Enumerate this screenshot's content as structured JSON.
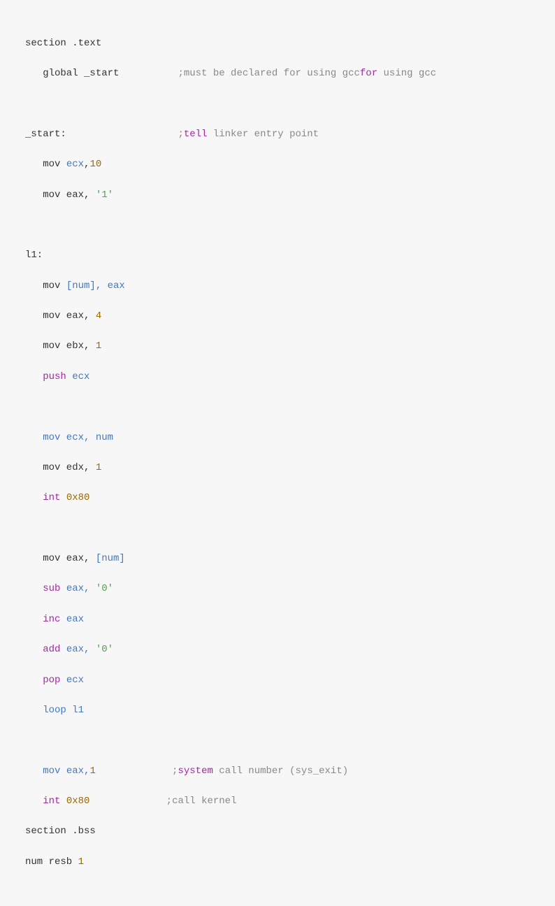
{
  "code": {
    "l0": {
      "a": "section .text"
    },
    "l1": {
      "a": "   global _start          ",
      "b": ";must be declared for using gcc",
      "c": "for",
      "d": " using gcc"
    },
    "l2": {
      "a": "_start:                   ",
      "b": ";",
      "c": "tell",
      "d": " linker entry point"
    },
    "l3": {
      "a": "   mov ",
      "b": "ecx",
      "c": ",",
      "d": "10"
    },
    "l4": {
      "a": "   mov eax, ",
      "b": "'1'"
    },
    "l5": {
      "a": "l1:"
    },
    "l6": {
      "a": "   mov ",
      "b": "[num], eax"
    },
    "l7": {
      "a": "   mov eax, ",
      "b": "4"
    },
    "l8": {
      "a": "   mov ebx, ",
      "b": "1"
    },
    "l9": {
      "a": "   ",
      "b": "push",
      "c": " ecx"
    },
    "l10": {
      "a": "   mov ecx, num"
    },
    "l11": {
      "a": "   mov edx, ",
      "b": "1"
    },
    "l12": {
      "a": "   ",
      "b": "int",
      "c": " ",
      "d": "0x80"
    },
    "l13": {
      "a": "   mov eax, ",
      "b": "[num]"
    },
    "l14": {
      "a": "   ",
      "b": "sub",
      "c": " eax, ",
      "d": "'0'"
    },
    "l15": {
      "a": "   ",
      "b": "inc",
      "c": " eax"
    },
    "l16": {
      "a": "   ",
      "b": "add",
      "c": " eax, ",
      "d": "'0'"
    },
    "l17": {
      "a": "   ",
      "b": "pop",
      "c": " ecx"
    },
    "l18": {
      "a": "   ",
      "b": "loop l1"
    },
    "l19": {
      "a": "   ",
      "b": "mov eax,",
      "c": "1",
      "d": "             ;",
      "e": "system",
      "f": " call number (sys_exit)"
    },
    "l20": {
      "a": "   ",
      "b": "int",
      "c": " ",
      "d": "0x80",
      "e": "             ;call kernel"
    },
    "l21": {
      "a": "section .bss"
    },
    "l22": {
      "a": "num resb ",
      "b": "1"
    }
  }
}
